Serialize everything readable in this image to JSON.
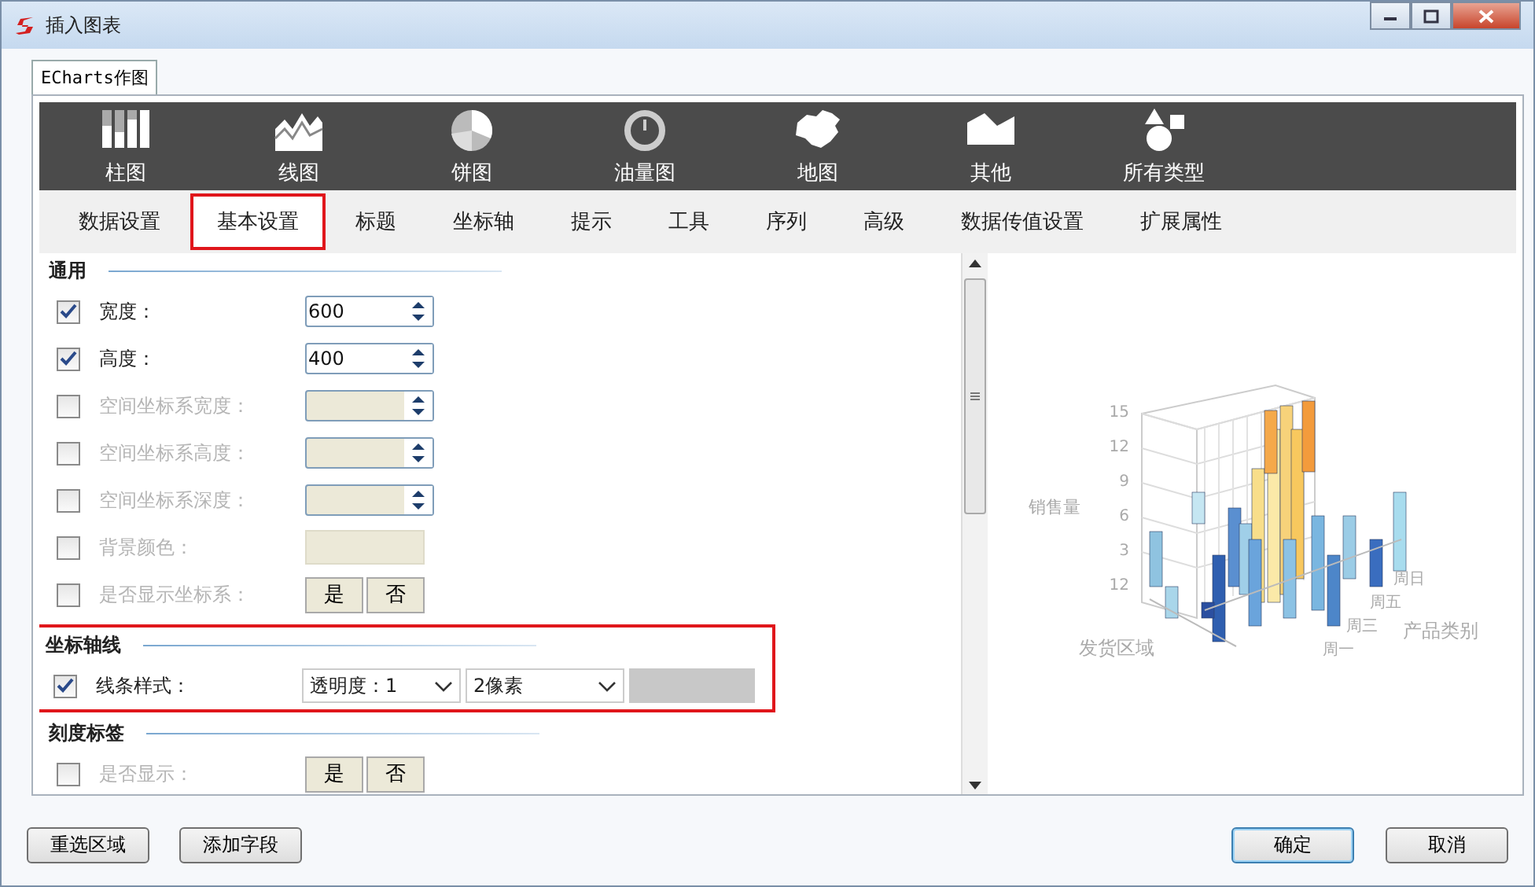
{
  "window": {
    "title": "插入图表"
  },
  "tab": {
    "label": "ECharts作图",
    "selected": true
  },
  "chart_types": [
    {
      "kind": "bar",
      "label": "柱图"
    },
    {
      "kind": "line",
      "label": "线图"
    },
    {
      "kind": "pie",
      "label": "饼图"
    },
    {
      "kind": "gauge",
      "label": "油量图"
    },
    {
      "kind": "map",
      "label": "地图"
    },
    {
      "kind": "other",
      "label": "其他"
    },
    {
      "kind": "all",
      "label": "所有类型"
    }
  ],
  "subtabs": [
    {
      "label": "数据设置",
      "selected": false
    },
    {
      "label": "基本设置",
      "selected": true
    },
    {
      "label": "标题",
      "selected": false
    },
    {
      "label": "坐标轴",
      "selected": false
    },
    {
      "label": "提示",
      "selected": false
    },
    {
      "label": "工具",
      "selected": false
    },
    {
      "label": "序列",
      "selected": false
    },
    {
      "label": "高级",
      "selected": false
    },
    {
      "label": "数据传值设置",
      "selected": false
    },
    {
      "label": "扩展属性",
      "selected": false
    }
  ],
  "sections": [
    {
      "title": "通用",
      "highlighted": false,
      "rows": [
        {
          "kind": "spinner",
          "label": "宽度：",
          "checked": true,
          "disabled": false,
          "value": "600"
        },
        {
          "kind": "spinner",
          "label": "高度：",
          "checked": true,
          "disabled": false,
          "value": "400"
        },
        {
          "kind": "spinner",
          "label": "空间坐标系宽度：",
          "checked": false,
          "disabled": true
        },
        {
          "kind": "spinner",
          "label": "空间坐标系高度：",
          "checked": false,
          "disabled": true
        },
        {
          "kind": "spinner",
          "label": "空间坐标系深度：",
          "checked": false,
          "disabled": true
        },
        {
          "kind": "color",
          "label": "背景颜色：",
          "checked": false,
          "disabled": true
        },
        {
          "kind": "toggle",
          "label": "是否显示坐标系：",
          "checked": false,
          "disabled": true,
          "options": [
            "是",
            "否"
          ]
        }
      ]
    },
    {
      "title": "坐标轴线",
      "highlighted": true,
      "rows": [
        {
          "kind": "line_style",
          "label": "线条样式：",
          "checked": true,
          "disabled": false,
          "selects": [
            "透明度：1",
            "2像素"
          ]
        }
      ]
    },
    {
      "title": "刻度标签",
      "highlighted": false,
      "rows": [
        {
          "kind": "toggle",
          "label": "是否显示：",
          "checked": false,
          "disabled": true,
          "options": [
            "是",
            "否"
          ]
        }
      ]
    }
  ],
  "preview": {
    "y_ticks": [
      "15",
      "12",
      "9",
      "6",
      "3",
      "12"
    ],
    "y_title": "销售量",
    "x_title": "发货区域",
    "z_title": "产品类别",
    "z_labels": [
      "周日",
      "周五",
      "周三",
      "周一"
    ]
  },
  "footer": {
    "left_buttons": [
      "重选区域",
      "添加字段"
    ],
    "right_buttons": [
      {
        "label": "确定",
        "default": true
      },
      {
        "label": "取消",
        "default": false
      }
    ]
  }
}
